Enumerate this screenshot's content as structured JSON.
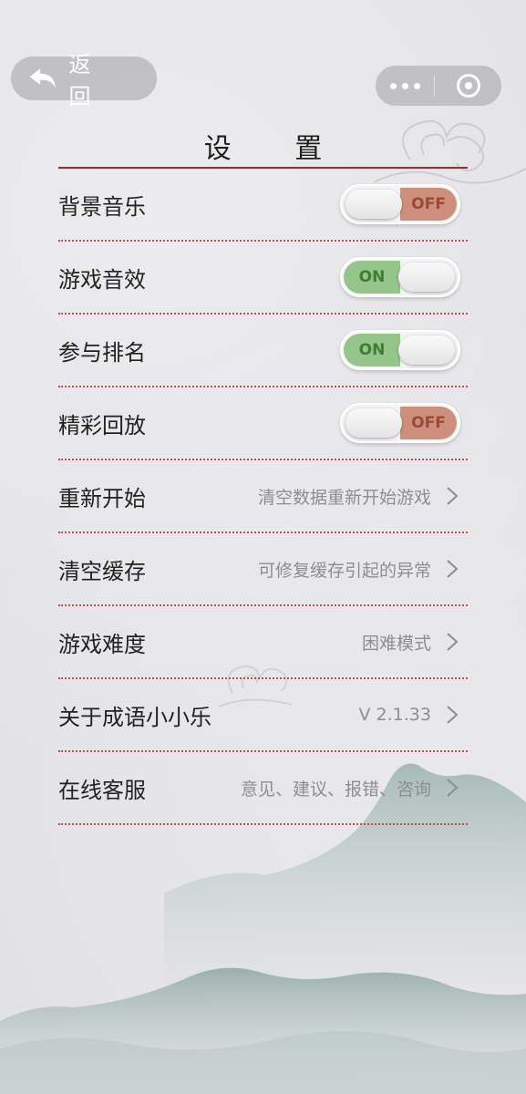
{
  "nav": {
    "back_label": "返 回"
  },
  "title": "设 置",
  "settings": [
    {
      "label": "背景音乐",
      "type": "toggle",
      "state": "off",
      "toggle_text": "OFF"
    },
    {
      "label": "游戏音效",
      "type": "toggle",
      "state": "on",
      "toggle_text": "ON"
    },
    {
      "label": "参与排名",
      "type": "toggle",
      "state": "on",
      "toggle_text": "ON"
    },
    {
      "label": "精彩回放",
      "type": "toggle",
      "state": "off",
      "toggle_text": "OFF"
    },
    {
      "label": "重新开始",
      "type": "link",
      "value": "清空数据重新开始游戏"
    },
    {
      "label": "清空缓存",
      "type": "link",
      "value": "可修复缓存引起的异常"
    },
    {
      "label": "游戏难度",
      "type": "link",
      "value": "困难模式"
    },
    {
      "label": "关于成语小小乐",
      "type": "link",
      "value": "V 2.1.33"
    },
    {
      "label": "在线客服",
      "type": "link",
      "value": "意见、建议、报错、咨询"
    }
  ],
  "colors": {
    "accent_rule": "#9a2e2e",
    "divider": "#b8504f",
    "toggle_on": "#95c58a",
    "toggle_off": "#cd8f7c"
  }
}
